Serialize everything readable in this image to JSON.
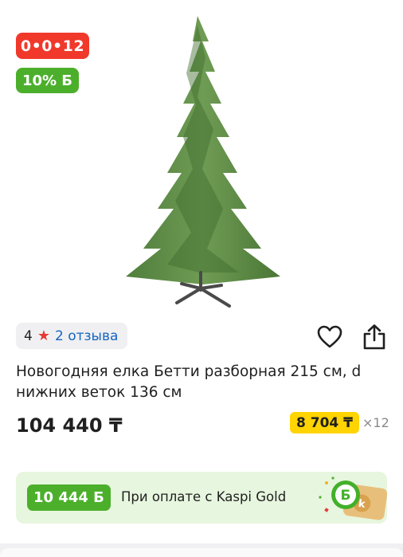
{
  "product": {
    "installment_badge": "0•0•12",
    "bonus_badge": "10% Б",
    "rating": "4",
    "reviews_link": "2 отзыва",
    "title": "Новогодняя елка Бетти разборная 215 см, d нижних веток 136 см",
    "price": "104 440 ₸",
    "monthly_payment": "8 704 ₸",
    "months": "×12"
  },
  "kaspi_banner": {
    "bonus": "10 444 Б",
    "text": "При оплате с Kaspi Gold"
  },
  "icons": {
    "star": "star-icon",
    "favorite": "heart-icon",
    "share": "share-icon"
  },
  "colors": {
    "installment_red": "#f0392b",
    "bonus_green": "#4caf2c",
    "monthly_yellow": "#ffd400",
    "link_blue": "#1565c0",
    "banner_bg": "#e7f6de"
  }
}
